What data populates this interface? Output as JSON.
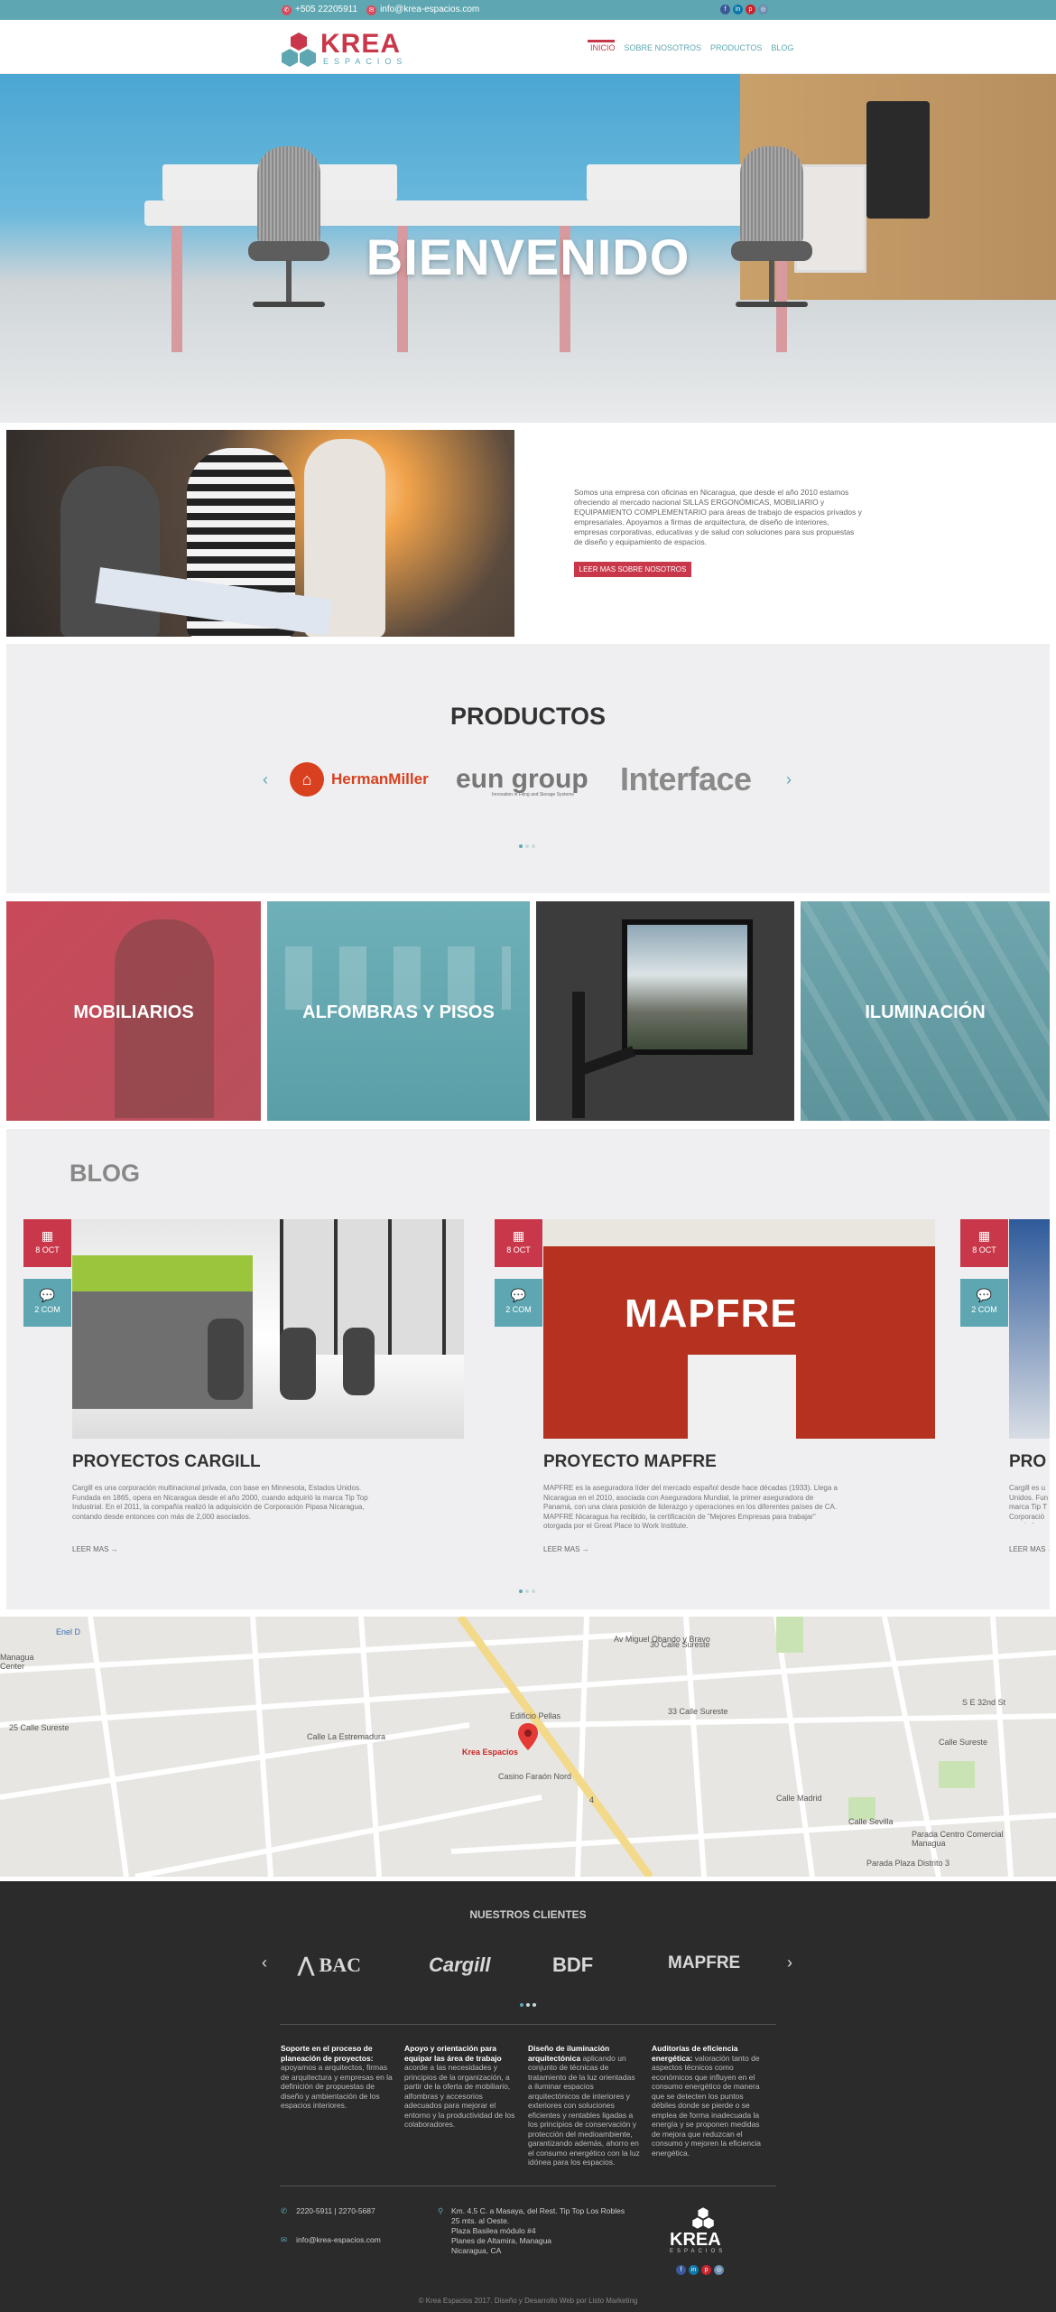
{
  "topbar": {
    "phone": "+505 22205911",
    "email": "info@krea-espacios.com",
    "social_icons": [
      "facebook-icon",
      "linkedin-icon",
      "pinterest-icon",
      "instagram-icon"
    ]
  },
  "header": {
    "logo_text": "KREA",
    "logo_sub": "ESPACIOS",
    "nav": [
      "INICIO",
      "SOBRE NOSOTROS",
      "PRODUCTOS",
      "BLOG"
    ],
    "active_nav": "INICIO"
  },
  "hero": {
    "title": "BIENVENIDO"
  },
  "about": {
    "text": "Somos una empresa con oficinas en Nicaragua, que desde el año 2010 estamos ofreciendo al mercado nacional SILLAS ERGONÓMICAS, MOBILIARIO y EQUIPAMIENTO COMPLEMENTARIO para áreas de trabajo de espacios privados y empresariales. Apoyamos a firmas de arquitectura, de diseño de interiores, empresas corporativas, educativas y de salud con soluciones para sus propuestas de diseño y equipamiento de espacios.",
    "button": "LEER MAS SOBRE NOSOTROS"
  },
  "products": {
    "title": "PRODUCTOS",
    "brands": [
      "HermanMiller",
      "eun group",
      "Interface"
    ],
    "eun_sub": "Innovation in Filing and Storage Systems",
    "prev": "‹",
    "next": "›"
  },
  "categories": [
    "MOBILIARIOS",
    "ALFOMBRAS Y PISOS",
    "",
    "ILUMINACIÓN"
  ],
  "blog": {
    "title": "BLOG",
    "posts": [
      {
        "date": "8 OCT",
        "comments": "2 COM",
        "title": "PROYECTOS CARGILL",
        "text": "Cargill es una corporación multinacional privada, con base en Minnesota, Estados Unidos. Fundada en 1865, opera en Nicaragua desde el año 2000, cuando adquirió la marca Tip Top Industrial. En el 2011, la compañía realizó la adquisición de Corporación Pipasa Nicaragua, contando desde entonces con más de 2,000 asociados.",
        "more": "LEER MAS →"
      },
      {
        "date": "8 OCT",
        "comments": "2 COM",
        "title": "PROYECTO MAPFRE",
        "text": "MAPFRE es la aseguradora líder del mercado español desde hace décadas (1933). Llega a Nicaragua en el 2010, asociada con Aseguradora Mundial, la primer aseguradora de Panamá, con una clara posición de liderazgo y operaciones en los diferentes países de CA. MAPFRE Nicaragua ha recibido, la certificación de \"Mejores Empresas para trabajar\" otorgada por el Great Place to Work Institute.",
        "more": "LEER MAS →",
        "image_text": "MAPFRE"
      },
      {
        "date": "8 OCT",
        "comments": "2 COM",
        "title": "PRO",
        "text": "Cargill es u Unidos. Fun marca Tip T Corporació asociados.",
        "more": "LEER MAS →"
      }
    ]
  },
  "map": {
    "pin_label": "Krea Espacios",
    "labels": [
      "Av Miguel Obando y Bravo",
      "Edificio Pellas",
      "Casino Faraón Nord",
      "33 Calle Sureste",
      "Calle Madrid",
      "Calle Sevilla",
      "Parada Centro Comercial Managua",
      "Parada Plaza Distrito 3",
      "Managua Center",
      "Calle La Estremadura",
      "Enel D",
      "4",
      "Calle Sureste",
      "S E 32nd St",
      "30 Calle Sureste",
      "25 Calle Sureste"
    ]
  },
  "footer": {
    "clients_title": "NUESTROS CLIENTES",
    "clients": [
      "BAC",
      "Cargill",
      "BDF",
      "MAPFRE"
    ],
    "services": [
      {
        "title": "Soporte en el proceso de planeación de proyectos:",
        "text": "apoyamos a arquitectos, firmas de arquitectura y empresas en la definición de propuestas de diseño y ambientación de los espacios interiores."
      },
      {
        "title": "Apoyo y orientación para equipar las área de trabajo",
        "text": "acorde a las necesidades y principios de la organización, a partir de la oferta de mobiliario, alfombras y accesorios adecuados para mejorar el entorno y la productividad de los colaboradores."
      },
      {
        "title": "Diseño de iluminación arquitectónica",
        "text": "aplicando un conjunto de técnicas de tratamiento de la luz orientadas a iluminar espacios arquitectónicos de interiores y exteriores con soluciones eficientes y rentables ligadas a los principios de conservación y protección del medioambiente, garantizando además, ahorro en el consumo energético con la luz idónea para los espacios."
      },
      {
        "title": "Auditorías de eficiencia energética:",
        "text": "valoración tanto de aspectos técnicos como económicos que influyen en el consumo energético de manera que se detecten los puntos débiles donde se pierde o se emplea de forma inadecuada la energía y se proponen medidas de mejora que reduzcan el consumo y mejoren la eficiencia energética."
      }
    ],
    "phone": "2220-5911  |  2270-5687",
    "email": "info@krea-espacios.com",
    "address": [
      "Km. 4.5 C. a Masaya, del Rest. Tip Top Los Robles",
      "25 mts. al Oeste.",
      "Plaza Basilea módulo #4",
      "Planes de Altamira, Managua",
      "Nicaragua, CA"
    ],
    "copyright": "© Krea Espacios 2017. Diseño y Desarrollo Web por Listo Marketing"
  },
  "colors": {
    "accent_red": "#c8384a",
    "accent_teal": "#5ea7b2",
    "footer_bg": "#2b2b2b"
  }
}
